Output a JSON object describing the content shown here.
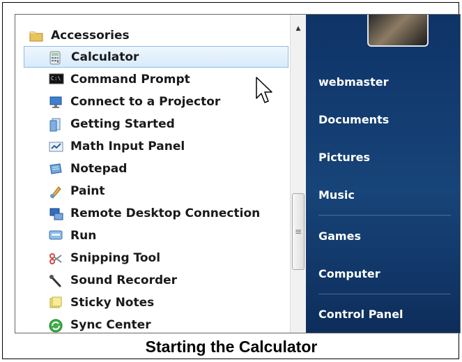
{
  "accessories_folder": {
    "label": "Accessories",
    "icon": "folder-icon"
  },
  "items": [
    {
      "label": "Calculator",
      "icon": "calculator-icon",
      "selected": true
    },
    {
      "label": "Command Prompt",
      "icon": "command-prompt-icon"
    },
    {
      "label": "Connect to a Projector",
      "icon": "projector-icon"
    },
    {
      "label": "Getting Started",
      "icon": "getting-started-icon"
    },
    {
      "label": "Math Input Panel",
      "icon": "math-input-icon"
    },
    {
      "label": "Notepad",
      "icon": "notepad-icon"
    },
    {
      "label": "Paint",
      "icon": "paint-icon"
    },
    {
      "label": "Remote Desktop Connection",
      "icon": "remote-desktop-icon"
    },
    {
      "label": "Run",
      "icon": "run-icon"
    },
    {
      "label": "Snipping Tool",
      "icon": "snipping-tool-icon"
    },
    {
      "label": "Sound Recorder",
      "icon": "microphone-icon"
    },
    {
      "label": "Sticky Notes",
      "icon": "sticky-notes-icon"
    },
    {
      "label": "Sync Center",
      "icon": "sync-center-icon"
    }
  ],
  "right_pane": {
    "user": "webmaster",
    "links": [
      "Documents",
      "Pictures",
      "Music",
      "Games",
      "Computer",
      "Control Panel"
    ]
  },
  "caption": "Starting the Calculator",
  "colors": {
    "selection": "#d8ebfb",
    "right_pane": "#123a6c"
  }
}
